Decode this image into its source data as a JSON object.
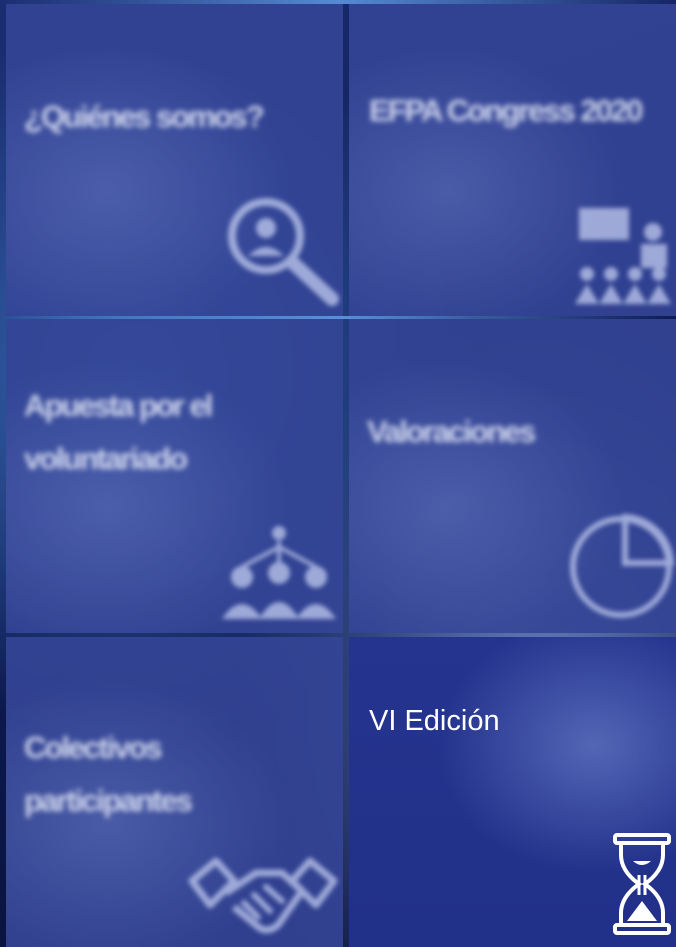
{
  "tiles": [
    {
      "id": "quienes-somos",
      "title": "¿Quiénes somos?",
      "icon": "magnifier-person-icon"
    },
    {
      "id": "efpa-congress",
      "title": "EFPA Congress 2020",
      "icon": "presentation-audience-icon"
    },
    {
      "id": "voluntariado",
      "title": "Apuesta por el\nvoluntariado",
      "icon": "team-network-icon"
    },
    {
      "id": "valoraciones",
      "title": "Valoraciones",
      "icon": "pie-chart-icon"
    },
    {
      "id": "colectivos",
      "title": "Colectivos\nparticipantes",
      "icon": "handshake-icon"
    },
    {
      "id": "vi-edicion",
      "title": "VI Edición",
      "icon": "hourglass-icon"
    }
  ],
  "colors": {
    "tile": "#3444a0",
    "tile_active": "#24338c",
    "text": "#ffffff",
    "divider": "#0b1240"
  }
}
